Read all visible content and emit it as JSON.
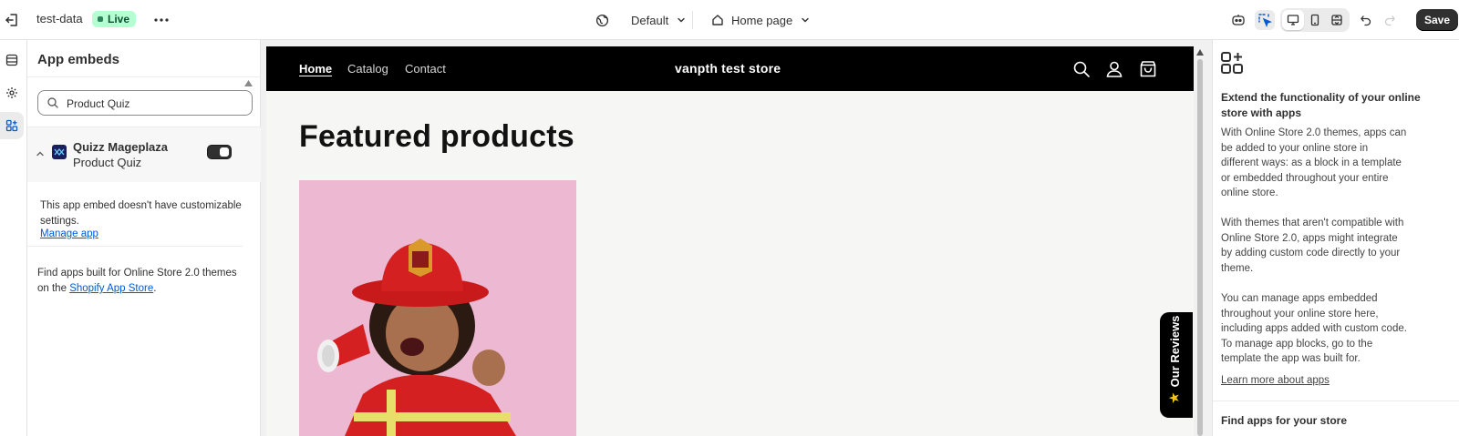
{
  "topbar": {
    "store_title": "test-data",
    "status_badge": "Live",
    "theme_select": "Default",
    "page_select": "Home page",
    "save_label": "Save"
  },
  "colors": {
    "accent": "#303030",
    "live_badge_bg": "#b4fed2",
    "link": "#005bd3",
    "store_header_bg": "#000000",
    "product_bg": "#ecb8d2"
  },
  "rail": {
    "items": [
      {
        "icon": "sections-icon"
      },
      {
        "icon": "settings-gear-icon"
      },
      {
        "icon": "app-embeds-icon"
      }
    ]
  },
  "panel": {
    "title": "App embeds",
    "search": {
      "value": "Product Quiz",
      "placeholder": "Search"
    },
    "embed": {
      "name": "Quizz Mageplaza",
      "subtitle": "Product Quiz",
      "enabled": true,
      "description": "This app embed doesn't have customizable settings.",
      "manage_link": "Manage app"
    },
    "find_text": "Find apps built for Online Store 2.0 themes on the",
    "find_link": "Shopify App Store",
    "find_end": "."
  },
  "store": {
    "nav": [
      "Home",
      "Catalog",
      "Contact"
    ],
    "name": "vanpth test store",
    "icons": [
      "search-icon",
      "account-icon",
      "cart-icon"
    ],
    "section_title": "Featured products",
    "reviews_tab": "Our Reviews"
  },
  "info": {
    "heading": "Extend the functionality of your online store with apps",
    "para1": "With Online Store 2.0 themes, apps can be added to your online store in different ways: as a block in a template or embedded throughout your entire online store.",
    "para2": "With themes that aren't compatible with Online Store 2.0, apps might integrate by adding custom code directly to your theme.",
    "para3": "You can manage apps embedded throughout your online store here, including apps added with custom code. To manage app blocks, go to the template the app was built for.",
    "learn_link": "Learn more about apps",
    "heading2": "Find apps for your store"
  }
}
